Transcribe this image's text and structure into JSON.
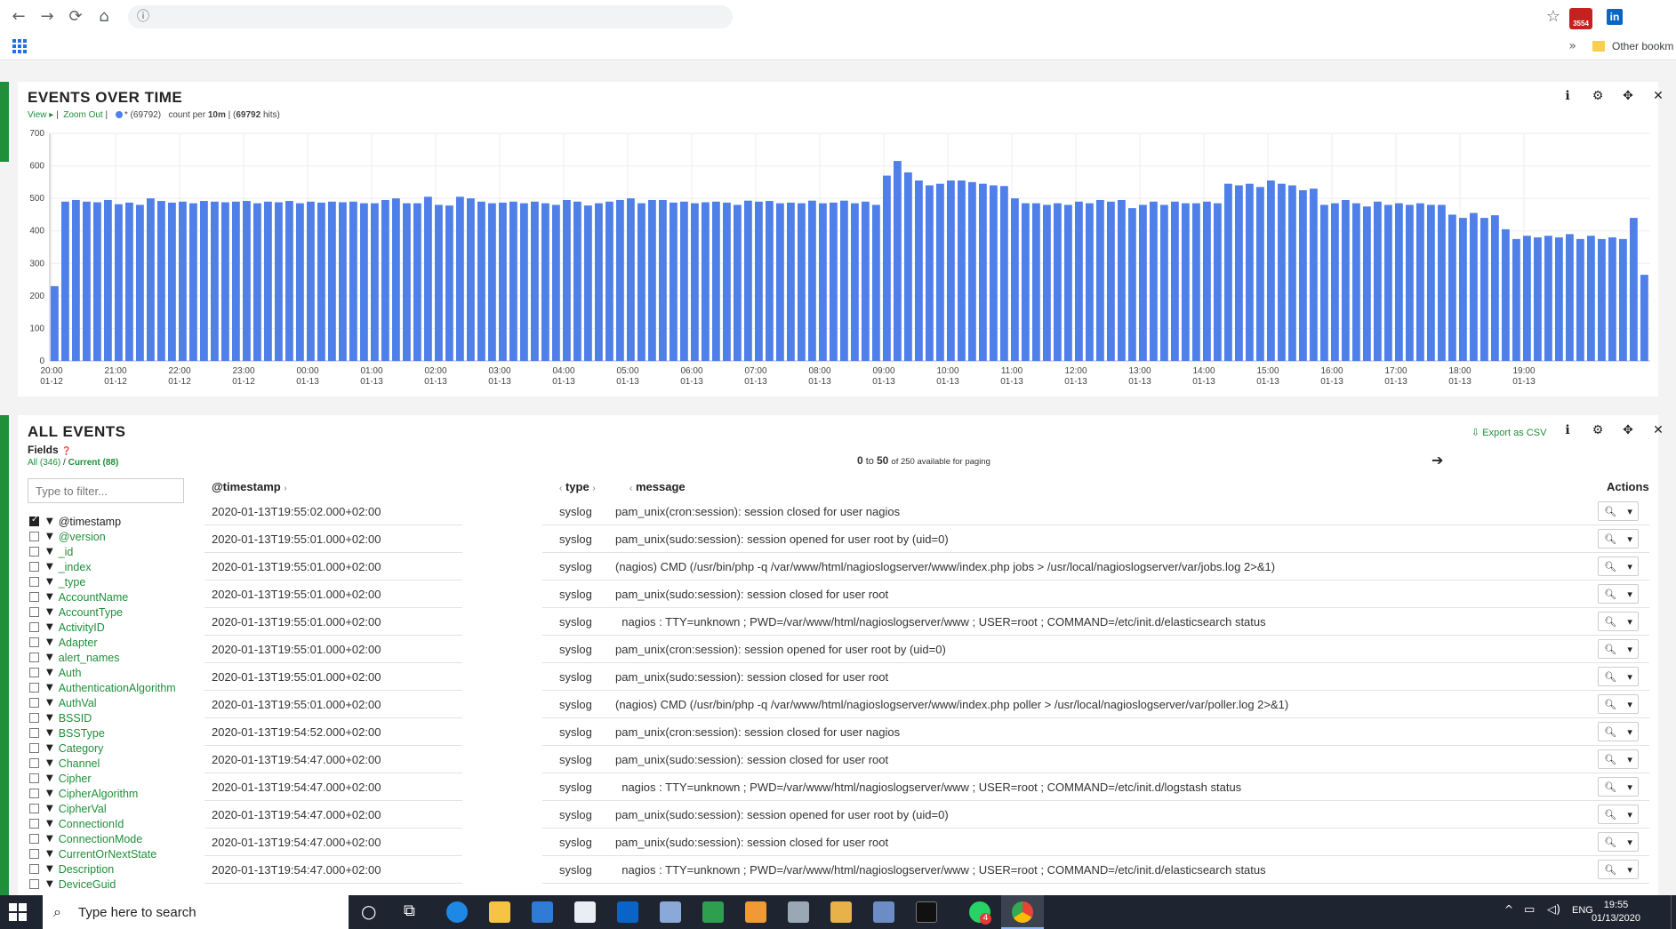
{
  "browser": {
    "back": "←",
    "forward": "→",
    "reload": "⟳",
    "home": "⌂",
    "info": "ⓘ",
    "star": "☆",
    "gmail_count": "3554",
    "linkedin": "in",
    "bookmarks_more": "»",
    "other_bookmarks": "Other bookm"
  },
  "events_over_time": {
    "title": "EVENTS OVER TIME",
    "view_link": "View ▸",
    "sep1": "|",
    "zoom_out": "Zoom Out",
    "sep2": "|",
    "query_label": "* (69792)",
    "count_per_prefix": "count per",
    "interval": "10m",
    "hits_open": "| (",
    "hits": "69792",
    "hits_close": "hits)",
    "icons": {
      "info": "ℹ",
      "settings": "⚙",
      "move": "✥",
      "close": "✕"
    }
  },
  "chart_data": {
    "type": "bar",
    "title": "",
    "xlabel": "",
    "ylabel": "",
    "ylim": [
      0,
      700
    ],
    "yticks": [
      0,
      100,
      200,
      300,
      400,
      500,
      600,
      700
    ],
    "x_ticks": [
      [
        "20:00",
        "01-12"
      ],
      [
        "21:00",
        "01-12"
      ],
      [
        "22:00",
        "01-12"
      ],
      [
        "23:00",
        "01-12"
      ],
      [
        "00:00",
        "01-13"
      ],
      [
        "01:00",
        "01-13"
      ],
      [
        "02:00",
        "01-13"
      ],
      [
        "03:00",
        "01-13"
      ],
      [
        "04:00",
        "01-13"
      ],
      [
        "05:00",
        "01-13"
      ],
      [
        "06:00",
        "01-13"
      ],
      [
        "07:00",
        "01-13"
      ],
      [
        "08:00",
        "01-13"
      ],
      [
        "09:00",
        "01-13"
      ],
      [
        "10:00",
        "01-13"
      ],
      [
        "11:00",
        "01-13"
      ],
      [
        "12:00",
        "01-13"
      ],
      [
        "13:00",
        "01-13"
      ],
      [
        "14:00",
        "01-13"
      ],
      [
        "15:00",
        "01-13"
      ],
      [
        "16:00",
        "01-13"
      ],
      [
        "17:00",
        "01-13"
      ],
      [
        "18:00",
        "01-13"
      ],
      [
        "19:00",
        "01-13"
      ]
    ],
    "bar_color": "#4f7fe8",
    "grid": true,
    "values": [
      230,
      490,
      495,
      490,
      488,
      495,
      482,
      487,
      480,
      500,
      492,
      487,
      490,
      485,
      492,
      490,
      488,
      490,
      492,
      485,
      490,
      488,
      492,
      485,
      490,
      487,
      490,
      488,
      490,
      485,
      485,
      495,
      500,
      485,
      485,
      505,
      480,
      478,
      505,
      500,
      490,
      485,
      487,
      490,
      485,
      490,
      485,
      480,
      495,
      490,
      478,
      485,
      490,
      495,
      500,
      485,
      495,
      495,
      487,
      490,
      485,
      488,
      490,
      487,
      480,
      493,
      490,
      492,
      485,
      487,
      485,
      493,
      485,
      487,
      493,
      485,
      490,
      480,
      570,
      615,
      580,
      555,
      540,
      545,
      555,
      555,
      550,
      545,
      540,
      538,
      500,
      485,
      485,
      480,
      485,
      480,
      490,
      485,
      495,
      490,
      495,
      470,
      480,
      490,
      480,
      490,
      485,
      485,
      490,
      485,
      545,
      540,
      545,
      535,
      555,
      545,
      540,
      525,
      530,
      480,
      485,
      495,
      485,
      475,
      490,
      480,
      485,
      480,
      485,
      480,
      480,
      450,
      440,
      455,
      440,
      448,
      405,
      375,
      385,
      380,
      385,
      380,
      390,
      375,
      385,
      375,
      380,
      375,
      440,
      265
    ]
  },
  "all_events": {
    "title": "ALL EVENTS",
    "export_csv": "Export as CSV",
    "icons": {
      "info": "ℹ",
      "settings": "⚙",
      "move": "✥",
      "close": "✕"
    },
    "fields_label": "Fields",
    "fields_help_icon": "❓",
    "fields_all": "All (346)",
    "fields_sep": "/",
    "fields_current": "Current (88)",
    "filter_placeholder": "Type to filter...",
    "paging_from": "0",
    "paging_to_word": "to",
    "paging_to": "50",
    "paging_rest": "of 250 available for paging",
    "next_arrow": "➔",
    "columns": {
      "timestamp": "@timestamp",
      "type": "type",
      "message": "message",
      "actions": "Actions"
    },
    "fields": [
      "@timestamp",
      "@version",
      "_id",
      "_index",
      "_type",
      "AccountName",
      "AccountType",
      "ActivityID",
      "Adapter",
      "alert_names",
      "Auth",
      "AuthenticationAlgorithm",
      "AuthVal",
      "BSSID",
      "BSSType",
      "Category",
      "Channel",
      "Cipher",
      "CipherAlgorithm",
      "CipherVal",
      "ConnectionId",
      "ConnectionMode",
      "CurrentOrNextState",
      "Description",
      "DeviceGuid"
    ],
    "rows": [
      {
        "ts": "2020-01-13T19:55:02.000+02:00",
        "type": "syslog",
        "msg": "pam_unix(cron:session): session closed for user nagios"
      },
      {
        "ts": "2020-01-13T19:55:01.000+02:00",
        "type": "syslog",
        "msg": "pam_unix(sudo:session): session opened for user root by (uid=0)"
      },
      {
        "ts": "2020-01-13T19:55:01.000+02:00",
        "type": "syslog",
        "msg": "(nagios) CMD (/usr/bin/php -q /var/www/html/nagioslogserver/www/index.php jobs > /usr/local/nagioslogserver/var/jobs.log 2>&1)"
      },
      {
        "ts": "2020-01-13T19:55:01.000+02:00",
        "type": "syslog",
        "msg": "pam_unix(sudo:session): session closed for user root"
      },
      {
        "ts": "2020-01-13T19:55:01.000+02:00",
        "type": "syslog",
        "msg": "  nagios : TTY=unknown ; PWD=/var/www/html/nagioslogserver/www ; USER=root ; COMMAND=/etc/init.d/elasticsearch status"
      },
      {
        "ts": "2020-01-13T19:55:01.000+02:00",
        "type": "syslog",
        "msg": "pam_unix(cron:session): session opened for user root by (uid=0)"
      },
      {
        "ts": "2020-01-13T19:55:01.000+02:00",
        "type": "syslog",
        "msg": "pam_unix(sudo:session): session closed for user root"
      },
      {
        "ts": "2020-01-13T19:55:01.000+02:00",
        "type": "syslog",
        "msg": "(nagios) CMD (/usr/bin/php -q /var/www/html/nagioslogserver/www/index.php poller > /usr/local/nagioslogserver/var/poller.log 2>&1)"
      },
      {
        "ts": "2020-01-13T19:54:52.000+02:00",
        "type": "syslog",
        "msg": "pam_unix(cron:session): session closed for user nagios"
      },
      {
        "ts": "2020-01-13T19:54:47.000+02:00",
        "type": "syslog",
        "msg": "pam_unix(sudo:session): session closed for user root"
      },
      {
        "ts": "2020-01-13T19:54:47.000+02:00",
        "type": "syslog",
        "msg": "  nagios : TTY=unknown ; PWD=/var/www/html/nagioslogserver/www ; USER=root ; COMMAND=/etc/init.d/logstash status"
      },
      {
        "ts": "2020-01-13T19:54:47.000+02:00",
        "type": "syslog",
        "msg": "pam_unix(sudo:session): session opened for user root by (uid=0)"
      },
      {
        "ts": "2020-01-13T19:54:47.000+02:00",
        "type": "syslog",
        "msg": "pam_unix(sudo:session): session closed for user root"
      },
      {
        "ts": "2020-01-13T19:54:47.000+02:00",
        "type": "syslog",
        "msg": "  nagios : TTY=unknown ; PWD=/var/www/html/nagioslogserver/www ; USER=root ; COMMAND=/etc/init.d/elasticsearch status"
      }
    ]
  },
  "taskbar": {
    "search_placeholder": "Type here to search",
    "search_icon": "⌕",
    "cortana_icon": "○",
    "taskview_icon": "⧉",
    "language": "ENG",
    "time": "19:55",
    "date": "01/13/2020",
    "tray_up": "^",
    "icons": [
      "edge",
      "explorer",
      "store",
      "mail",
      "outlook",
      "virtualbox",
      "excel",
      "sublime",
      "paint",
      "folder-tool",
      "network-tool",
      "terminal",
      "whatsapp",
      "chrome"
    ],
    "whatsapp_badge": "4"
  }
}
